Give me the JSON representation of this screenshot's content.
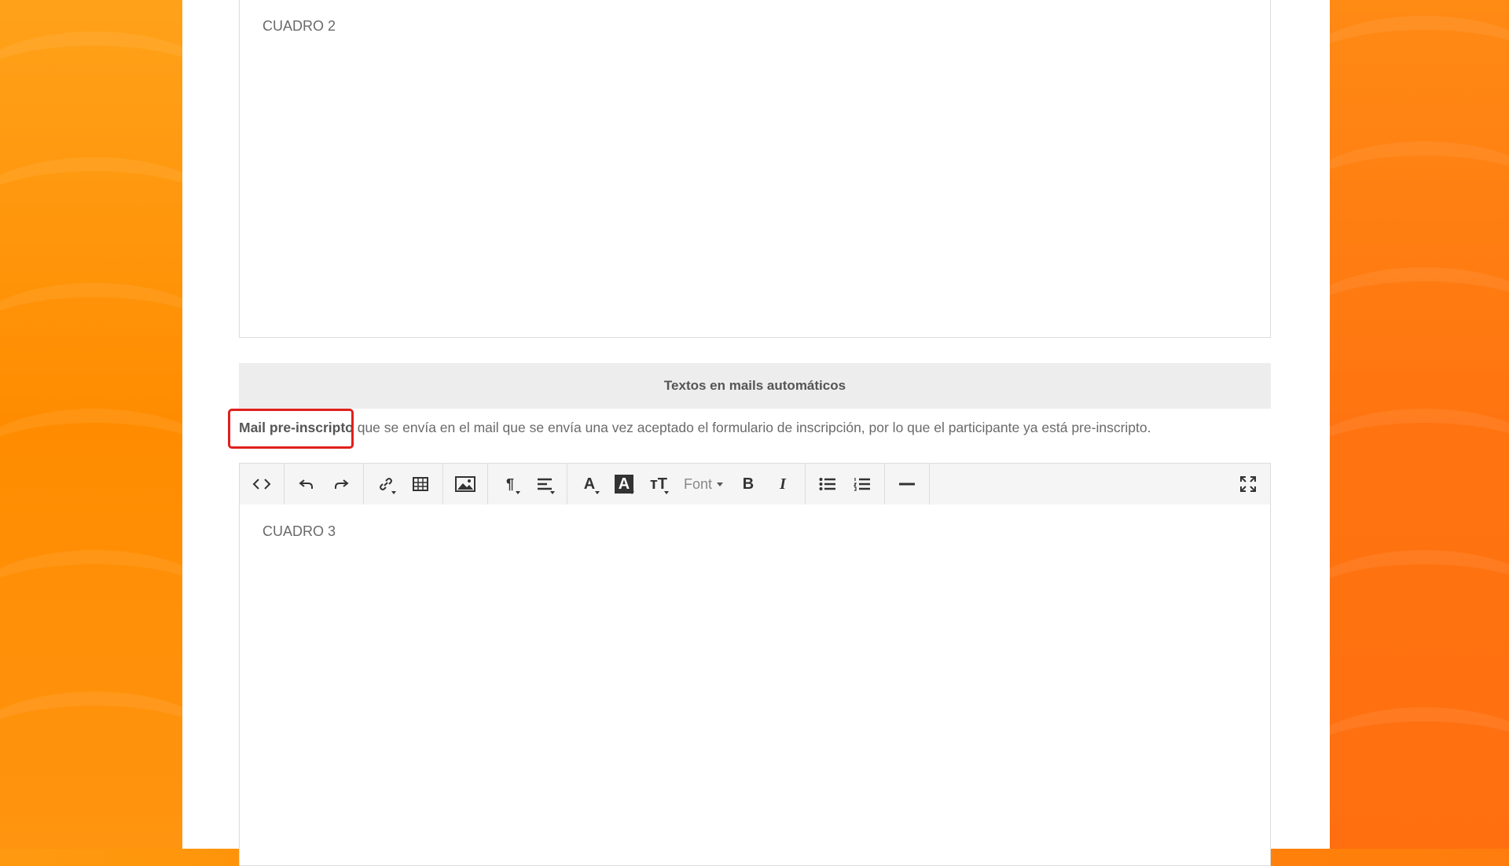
{
  "editor_top": {
    "content": "CUADRO 2"
  },
  "section": {
    "title": "Textos en mails automáticos"
  },
  "description": {
    "bold": "Mail pre-inscripto",
    "rest": " que se envía en el mail que se envía una vez aceptado el formulario de inscripción, por lo que el participante ya está pre-inscripto."
  },
  "toolbar": {
    "font_label": "Font",
    "bold_label": "B",
    "italic_label": "I",
    "paragraph_label": "¶",
    "font_color_label": "A",
    "bg_color_label": "A",
    "font_size_label": "тT"
  },
  "editor_bottom": {
    "content": "CUADRO 3"
  },
  "colors": {
    "accent": "#ff8c00",
    "highlight": "#e0201c"
  }
}
